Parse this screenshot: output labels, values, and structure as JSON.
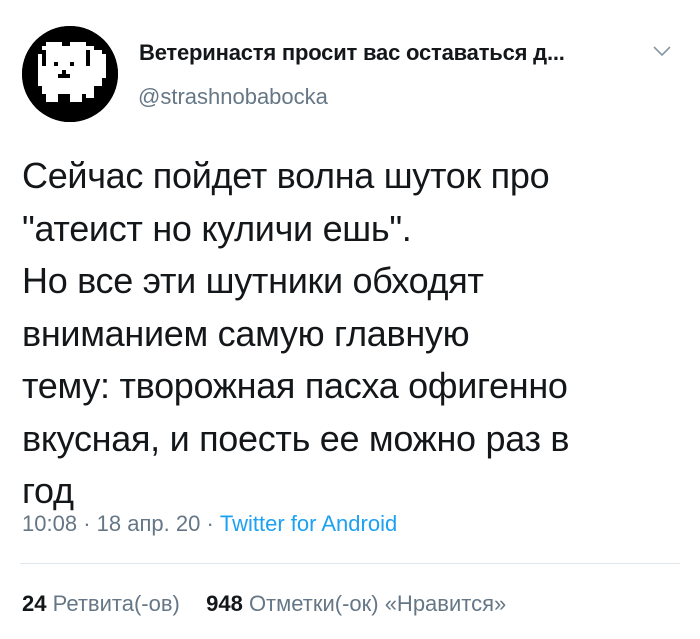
{
  "author": {
    "display_name": "Ветеринастя просит вас оставаться д...",
    "handle": "@strashnobabocka",
    "avatar_icon": "pixel-dog-avatar"
  },
  "menu_icon": "chevron-down-icon",
  "tweet": {
    "lines": [
      "Сейчас пойдет волна шуток про",
      "\"атеист но куличи ешь\".",
      "Но все эти шутники обходят",
      "вниманием самую главную",
      "тему: творожная пасха офигенно",
      "вкусная, и поесть ее можно раз в",
      "год"
    ]
  },
  "meta": {
    "time": "10:08",
    "separator": "·",
    "date": "18 апр. 20",
    "source": "Twitter for Android"
  },
  "stats": {
    "retweets_count": "24",
    "retweets_label": "Ретвита(-ов)",
    "likes_count": "948",
    "likes_label": "Отметки(-ок) «Нравится»"
  },
  "colors": {
    "text": "#14171a",
    "secondary": "#657786",
    "link": "#1da1f2",
    "divider": "#e1e8ed"
  }
}
